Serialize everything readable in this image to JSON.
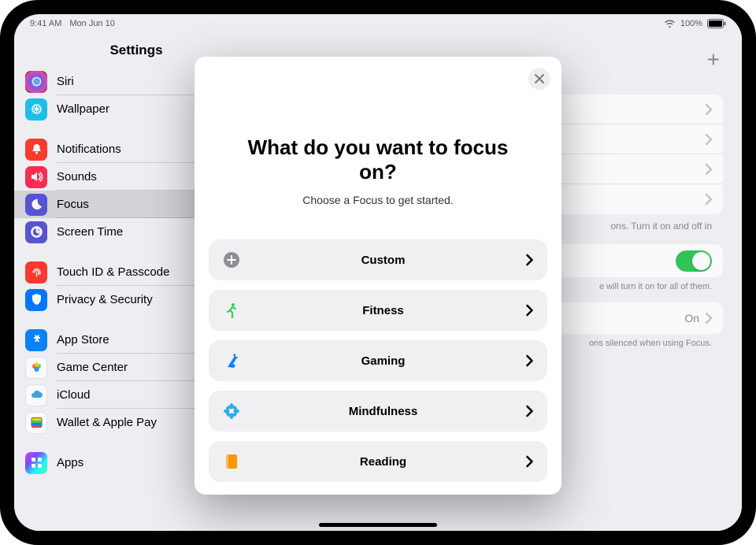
{
  "status": {
    "time": "9:41 AM",
    "date": "Mon Jun 10",
    "battery": "100%"
  },
  "sidebar": {
    "title": "Settings",
    "groups": [
      {
        "items": [
          {
            "id": "siri",
            "label": "Siri",
            "icon": "siri"
          },
          {
            "id": "wallpaper",
            "label": "Wallpaper",
            "icon": "wallpaper"
          }
        ]
      },
      {
        "items": [
          {
            "id": "notifications",
            "label": "Notifications",
            "icon": "notifications"
          },
          {
            "id": "sounds",
            "label": "Sounds",
            "icon": "sounds"
          },
          {
            "id": "focus",
            "label": "Focus",
            "icon": "focus",
            "selected": true
          },
          {
            "id": "screentime",
            "label": "Screen Time",
            "icon": "screentime"
          }
        ]
      },
      {
        "items": [
          {
            "id": "touchid",
            "label": "Touch ID & Passcode",
            "icon": "touchid"
          },
          {
            "id": "privacy",
            "label": "Privacy & Security",
            "icon": "privacy"
          }
        ]
      },
      {
        "items": [
          {
            "id": "appstore",
            "label": "App Store",
            "icon": "appstore"
          },
          {
            "id": "gamecenter",
            "label": "Game Center",
            "icon": "gamecenter"
          },
          {
            "id": "icloud",
            "label": "iCloud",
            "icon": "icloud"
          },
          {
            "id": "wallet",
            "label": "Wallet & Apple Pay",
            "icon": "wallet"
          }
        ]
      },
      {
        "items": [
          {
            "id": "apps",
            "label": "Apps",
            "icon": "apps"
          }
        ]
      }
    ]
  },
  "detail": {
    "note1_suffix": "ons. Turn it on and off in",
    "note2_suffix": "e will turn it on for all of them.",
    "status_value": "On",
    "note3_suffix": "ons silenced when using Focus."
  },
  "modal": {
    "title": "What do you want to focus on?",
    "subtitle": "Choose a Focus to get started.",
    "options": [
      {
        "id": "custom",
        "label": "Custom",
        "icon": "plus",
        "color": "#8e8e93"
      },
      {
        "id": "fitness",
        "label": "Fitness",
        "icon": "fitness",
        "color": "#30d158"
      },
      {
        "id": "gaming",
        "label": "Gaming",
        "icon": "gaming",
        "color": "#0a84ff"
      },
      {
        "id": "mindfulness",
        "label": "Mindfulness",
        "icon": "mindfulness",
        "color": "#32ade6"
      },
      {
        "id": "reading",
        "label": "Reading",
        "icon": "reading",
        "color": "#ff9500"
      }
    ]
  }
}
